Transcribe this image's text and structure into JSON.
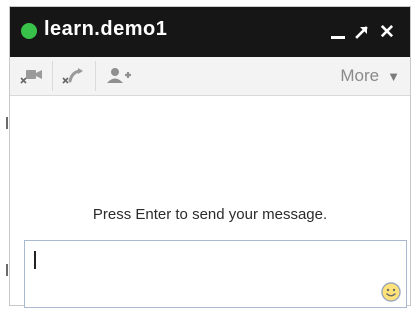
{
  "chat": {
    "contact_name": "learn.demo1",
    "status_color": "#39c24a",
    "title_controls": {
      "minimize_icon": "minimize-icon",
      "popout_icon": "popout-arrow-icon",
      "close_icon": "close-icon",
      "close_glyph": "✕"
    },
    "toolbar": {
      "video_icon": "video-call-disabled-icon",
      "call_icon": "phone-call-disabled-icon",
      "add_people_icon": "add-person-icon",
      "more_label": "More",
      "more_caret": "▼"
    },
    "hint": "Press Enter to send your message.",
    "input": {
      "value": "",
      "emoji_icon": "smiley-icon"
    }
  },
  "colors": {
    "titlebar": "#161616",
    "toolbar": "#f3f3f3",
    "input_border": "#a9b9cf"
  }
}
